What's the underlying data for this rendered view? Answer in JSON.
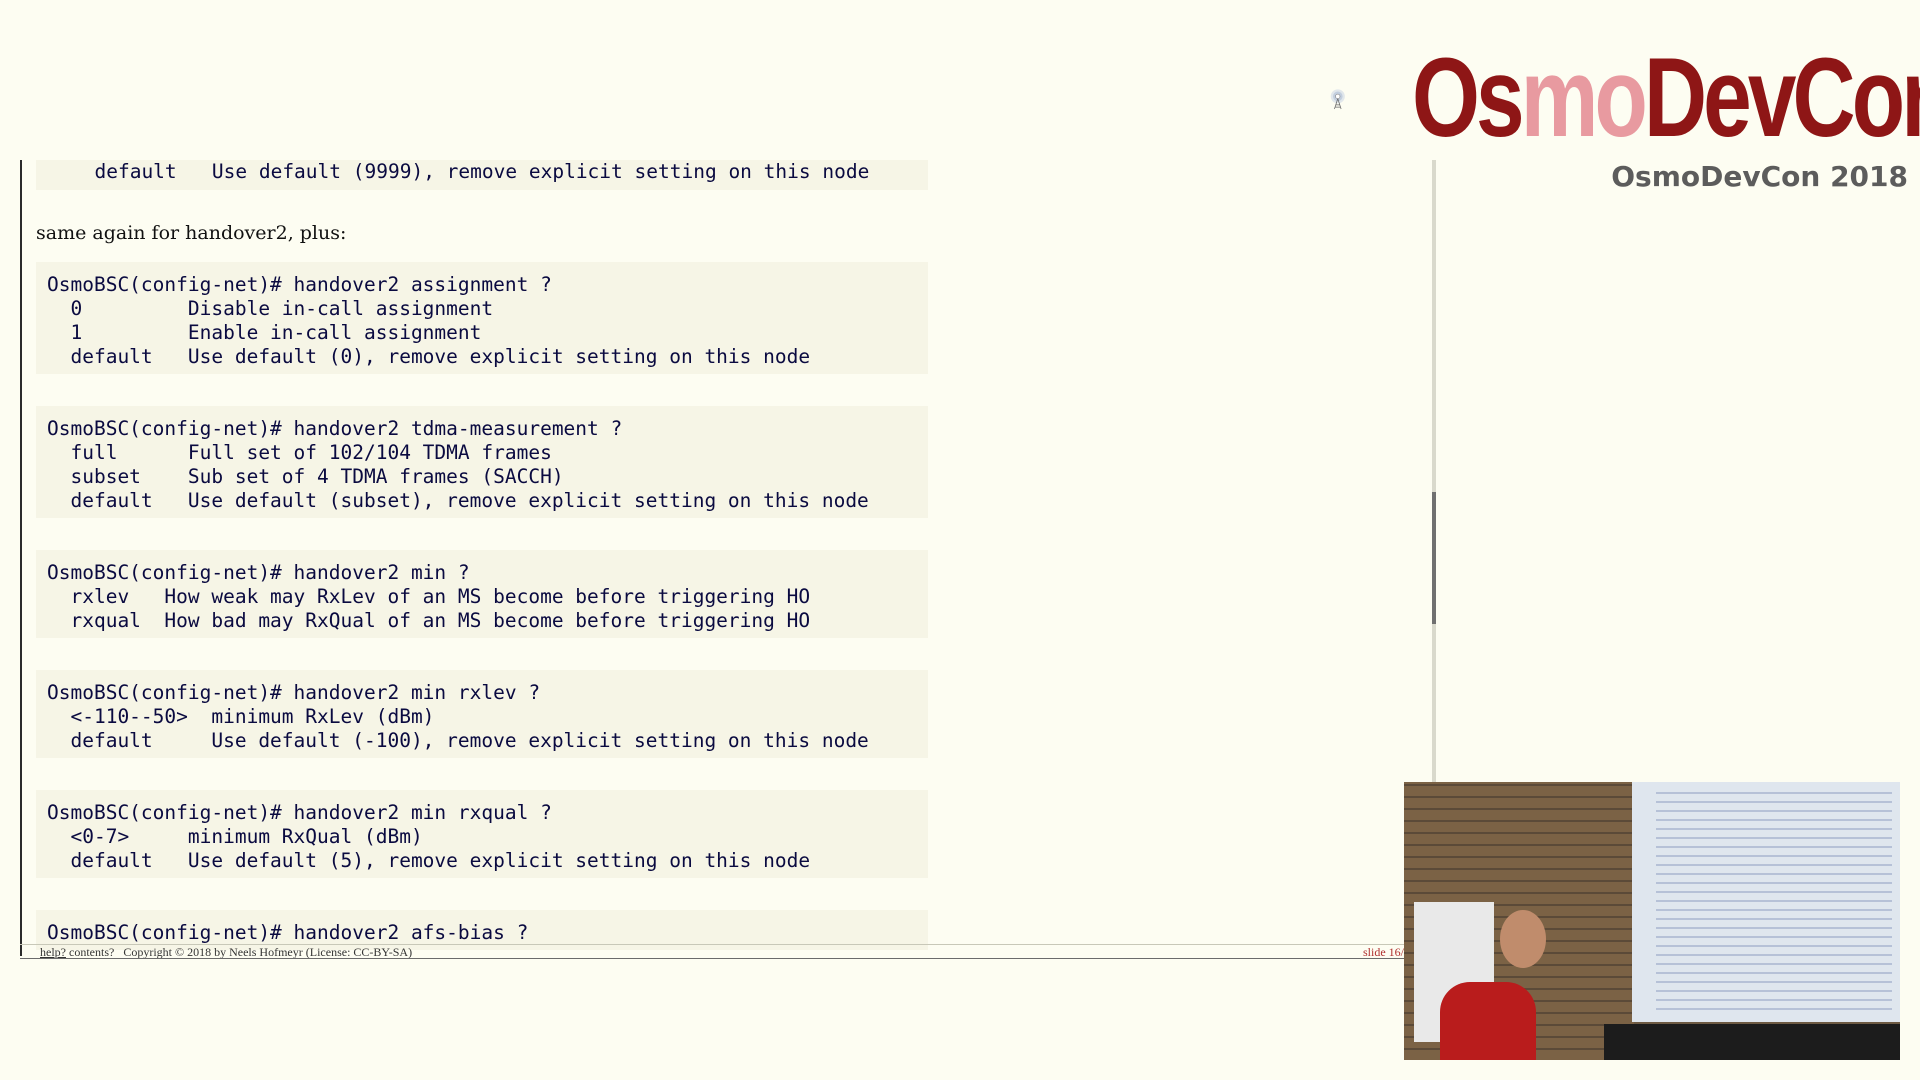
{
  "brand": {
    "logo_text_a": "Os",
    "logo_text_mo": "mo",
    "logo_text_b": "DevCon",
    "event_title": "OsmoDevCon 2018"
  },
  "slide": {
    "lines": [
      {
        "text": "  default   Use default (9999), remove explicit setting on this node",
        "kind": "code"
      },
      {
        "text": "same again for handover2, plus:",
        "kind": "prose"
      },
      {
        "text": "OsmoBSC(config-net)# handover2 assignment ?",
        "kind": "code"
      },
      {
        "text": "  0         Disable in-call assignment",
        "kind": "code"
      },
      {
        "text": "  1         Enable in-call assignment",
        "kind": "code"
      },
      {
        "text": "  default   Use default (0), remove explicit setting on this node",
        "kind": "code"
      },
      {
        "text": "OsmoBSC(config-net)# handover2 tdma-measurement ?",
        "kind": "code"
      },
      {
        "text": "  full      Full set of 102/104 TDMA frames",
        "kind": "code"
      },
      {
        "text": "  subset    Sub set of 4 TDMA frames (SACCH)",
        "kind": "code"
      },
      {
        "text": "  default   Use default (subset), remove explicit setting on this node",
        "kind": "code"
      },
      {
        "text": "OsmoBSC(config-net)# handover2 min ?",
        "kind": "code"
      },
      {
        "text": "  rxlev   How weak may RxLev of an MS become before triggering HO",
        "kind": "code"
      },
      {
        "text": "  rxqual  How bad may RxQual of an MS become before triggering HO",
        "kind": "code"
      },
      {
        "text": "OsmoBSC(config-net)# handover2 min rxlev ?",
        "kind": "code"
      },
      {
        "text": "  <-110--50>  minimum RxLev (dBm)",
        "kind": "code"
      },
      {
        "text": "  default     Use default (-100), remove explicit setting on this node",
        "kind": "code"
      },
      {
        "text": "OsmoBSC(config-net)# handover2 min rxqual ?",
        "kind": "code"
      },
      {
        "text": "  <0-7>     minimum RxQual (dBm)",
        "kind": "code"
      },
      {
        "text": "  default   Use default (5), remove explicit setting on this node",
        "kind": "code"
      },
      {
        "text": "OsmoBSC(config-net)# handover2 afs-bias ?",
        "kind": "code"
      }
    ],
    "footer": {
      "help": "help?",
      "contents": "contents?",
      "copyright": "Copyright © 2018 by Neels Hofmeyr (License: CC-BY-SA)",
      "slide_no": "slide 16/"
    }
  },
  "colors": {
    "brand": "#8e1616",
    "background": "#fdfdf2",
    "code_text": "#0a0a40"
  }
}
